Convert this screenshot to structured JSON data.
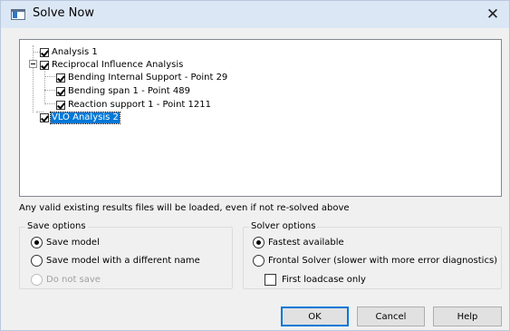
{
  "window": {
    "title": "Solve Now",
    "close_glyph": "✕"
  },
  "tree": {
    "items": [
      {
        "label": "Analysis 1",
        "checked": true
      },
      {
        "label": "Reciprocal Influence Analysis",
        "checked": true,
        "expanded": true,
        "children": [
          {
            "label": "Bending Internal Support - Point 29",
            "checked": true
          },
          {
            "label": "Bending span 1 - Point 489",
            "checked": true
          },
          {
            "label": "Reaction support 1 - Point 1211",
            "checked": true
          }
        ]
      },
      {
        "label": "VLO Analysis 2",
        "checked": true,
        "selected": true
      }
    ]
  },
  "notice": "Any valid existing results files will be loaded, even if not re-solved above",
  "save_options": {
    "title": "Save options",
    "options": [
      {
        "label": "Save model",
        "selected": true,
        "enabled": true
      },
      {
        "label": "Save model with a different name",
        "selected": false,
        "enabled": true
      },
      {
        "label": "Do not save",
        "selected": false,
        "enabled": false
      }
    ]
  },
  "solver_options": {
    "title": "Solver options",
    "options": [
      {
        "label": "Fastest available",
        "selected": true
      },
      {
        "label": "Frontal Solver (slower with more error diagnostics)",
        "selected": false
      }
    ],
    "first_loadcase_label": "First loadcase only",
    "first_loadcase_checked": false
  },
  "buttons": {
    "ok": "OK",
    "cancel": "Cancel",
    "help": "Help"
  },
  "colors": {
    "selection": "#0078d7",
    "titlebar": "#dce7f5"
  }
}
